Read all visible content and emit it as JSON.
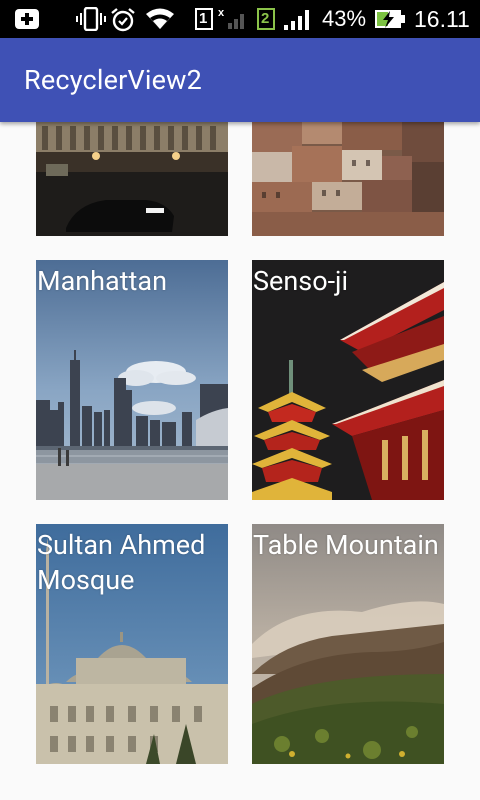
{
  "status_bar": {
    "sim1": "1",
    "sim2": "2",
    "battery_percent": "43%",
    "time": "16.11",
    "icons": [
      "notification-plus-icon",
      "vibrate-icon",
      "alarm-icon",
      "wifi-icon",
      "sim1-icon",
      "signal-icon",
      "sim2-icon",
      "signal-icon",
      "battery-charging-icon"
    ]
  },
  "app_bar": {
    "title": "RecyclerView2"
  },
  "cards": [
    {
      "label": ""
    },
    {
      "label": ""
    },
    {
      "label": "Manhattan"
    },
    {
      "label": "Senso-ji"
    },
    {
      "label": "Sultan Ahmed Mosque"
    },
    {
      "label": "Table Mountain"
    }
  ],
  "colors": {
    "primary": "#3f51b5",
    "status_bar": "#000000",
    "background": "#fafafa"
  }
}
